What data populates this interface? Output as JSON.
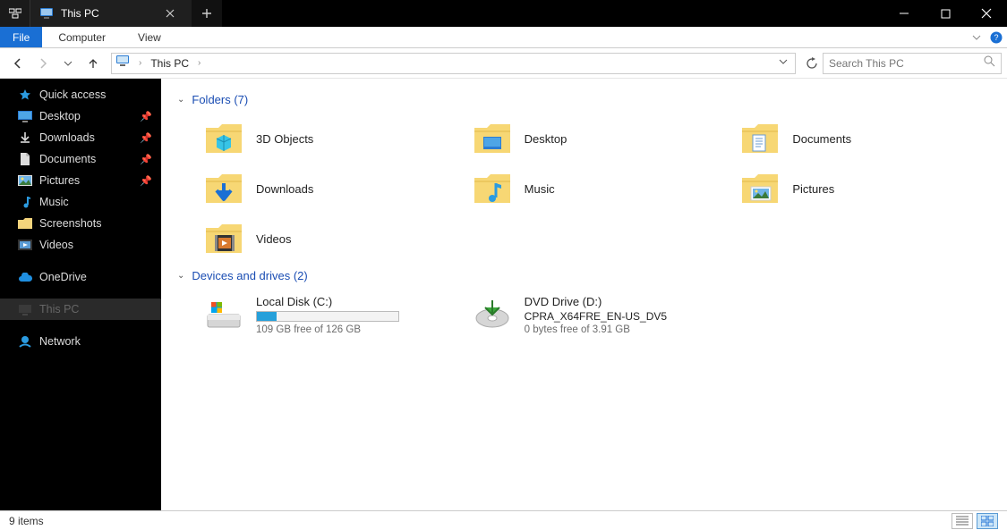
{
  "title": "This PC",
  "ribbon": {
    "file": "File",
    "computer": "Computer",
    "view": "View"
  },
  "breadcrumb": "This PC",
  "search_placeholder": "Search This PC",
  "sidebar": {
    "quick_access": "Quick access",
    "desktop": "Desktop",
    "downloads": "Downloads",
    "documents": "Documents",
    "pictures": "Pictures",
    "music": "Music",
    "screenshots": "Screenshots",
    "videos": "Videos",
    "onedrive": "OneDrive",
    "this_pc": "This PC",
    "network": "Network"
  },
  "groups": {
    "folders_header": "Folders (7)",
    "drives_header": "Devices and drives (2)"
  },
  "folders": {
    "0": "3D Objects",
    "1": "Desktop",
    "2": "Documents",
    "3": "Downloads",
    "4": "Music",
    "5": "Pictures",
    "6": "Videos"
  },
  "drives": {
    "c": {
      "name": "Local Disk (C:)",
      "sub": "109 GB free of 126 GB",
      "fill_pct": 14
    },
    "d": {
      "name": "DVD Drive (D:)",
      "label": "CPRA_X64FRE_EN-US_DV5",
      "sub": "0 bytes free of 3.91 GB"
    }
  },
  "status": "9 items"
}
